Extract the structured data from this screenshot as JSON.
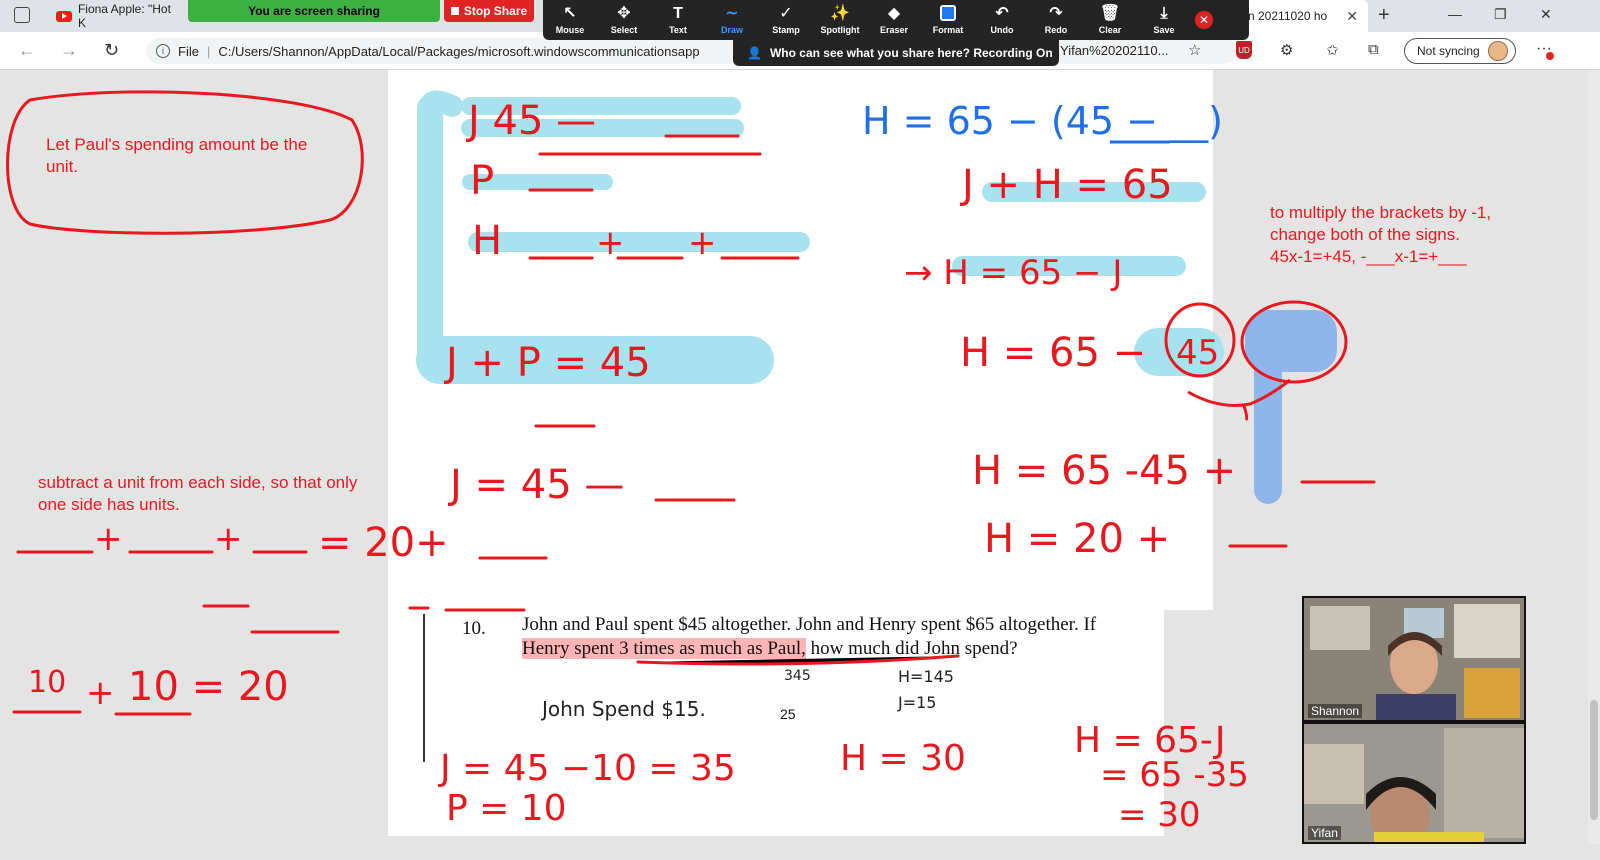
{
  "tabs": {
    "left_title": "Fiona Apple: \"Hot K",
    "right_title": "n 20211020 ho",
    "new_tab": "+"
  },
  "share": {
    "status": "You are screen sharing",
    "stop_label": "Stop Share"
  },
  "toolbar": {
    "tools": [
      {
        "label": "Mouse",
        "icon": "↖"
      },
      {
        "label": "Select",
        "icon": "✥"
      },
      {
        "label": "Text",
        "icon": "T"
      },
      {
        "label": "Draw",
        "icon": "∼"
      },
      {
        "label": "Stamp",
        "icon": "✓"
      },
      {
        "label": "Spotlight",
        "icon": "✨"
      },
      {
        "label": "Eraser",
        "icon": "◆"
      },
      {
        "label": "Format",
        "icon": ""
      },
      {
        "label": "Undo",
        "icon": "↶"
      },
      {
        "label": "Redo",
        "icon": "↷"
      },
      {
        "label": "Clear",
        "icon": "🗑"
      },
      {
        "label": "Save",
        "icon": "⤓"
      }
    ],
    "active": "Draw",
    "recording_text": "Who can see what you share here? Recording On"
  },
  "address": {
    "file_label": "File",
    "url": "C:/Users/Shannon/AppData/Local/Packages/microsoft.windowscommunicationsapp",
    "url_tail": "Yifan%20202110...",
    "sync_label": "Not syncing"
  },
  "notes": {
    "unit_note": "Let Paul's spending amount be the unit.",
    "subtract_note": "subtract a unit from each side, so that only one side has units.",
    "multiply_note_1": "to multiply the brackets by -1, change both of the signs.",
    "multiply_note_2": "45x-1=+45, -___x-1=+___"
  },
  "problem": {
    "number": "10.",
    "text_before": "John and Paul spent $45 altogether. John and Henry spent $65 altogether. If ",
    "highlighted": "Henry spent 3 times as much as Paul,",
    "text_after": " how much did John spend?",
    "page": "25"
  },
  "video": {
    "top_name": "Shannon",
    "bottom_name": "Yifan"
  },
  "colors": {
    "ink_red": "#e8191e",
    "ink_blue": "#1e6fe8",
    "highlight_cyan": "#a9e2ef",
    "toolbar_dark": "#242424"
  }
}
